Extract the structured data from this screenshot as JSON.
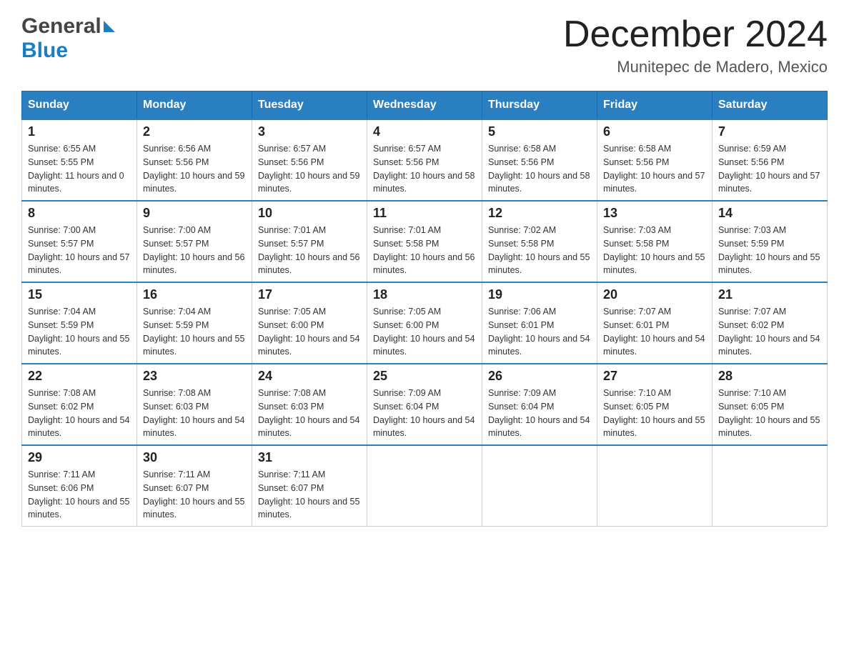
{
  "header": {
    "title": "December 2024",
    "subtitle": "Munitepec de Madero, Mexico",
    "logo_general": "General",
    "logo_blue": "Blue"
  },
  "days_of_week": [
    "Sunday",
    "Monday",
    "Tuesday",
    "Wednesday",
    "Thursday",
    "Friday",
    "Saturday"
  ],
  "weeks": [
    [
      {
        "day": "1",
        "sunrise": "6:55 AM",
        "sunset": "5:55 PM",
        "daylight": "11 hours and 0 minutes."
      },
      {
        "day": "2",
        "sunrise": "6:56 AM",
        "sunset": "5:56 PM",
        "daylight": "10 hours and 59 minutes."
      },
      {
        "day": "3",
        "sunrise": "6:57 AM",
        "sunset": "5:56 PM",
        "daylight": "10 hours and 59 minutes."
      },
      {
        "day": "4",
        "sunrise": "6:57 AM",
        "sunset": "5:56 PM",
        "daylight": "10 hours and 58 minutes."
      },
      {
        "day": "5",
        "sunrise": "6:58 AM",
        "sunset": "5:56 PM",
        "daylight": "10 hours and 58 minutes."
      },
      {
        "day": "6",
        "sunrise": "6:58 AM",
        "sunset": "5:56 PM",
        "daylight": "10 hours and 57 minutes."
      },
      {
        "day": "7",
        "sunrise": "6:59 AM",
        "sunset": "5:56 PM",
        "daylight": "10 hours and 57 minutes."
      }
    ],
    [
      {
        "day": "8",
        "sunrise": "7:00 AM",
        "sunset": "5:57 PM",
        "daylight": "10 hours and 57 minutes."
      },
      {
        "day": "9",
        "sunrise": "7:00 AM",
        "sunset": "5:57 PM",
        "daylight": "10 hours and 56 minutes."
      },
      {
        "day": "10",
        "sunrise": "7:01 AM",
        "sunset": "5:57 PM",
        "daylight": "10 hours and 56 minutes."
      },
      {
        "day": "11",
        "sunrise": "7:01 AM",
        "sunset": "5:58 PM",
        "daylight": "10 hours and 56 minutes."
      },
      {
        "day": "12",
        "sunrise": "7:02 AM",
        "sunset": "5:58 PM",
        "daylight": "10 hours and 55 minutes."
      },
      {
        "day": "13",
        "sunrise": "7:03 AM",
        "sunset": "5:58 PM",
        "daylight": "10 hours and 55 minutes."
      },
      {
        "day": "14",
        "sunrise": "7:03 AM",
        "sunset": "5:59 PM",
        "daylight": "10 hours and 55 minutes."
      }
    ],
    [
      {
        "day": "15",
        "sunrise": "7:04 AM",
        "sunset": "5:59 PM",
        "daylight": "10 hours and 55 minutes."
      },
      {
        "day": "16",
        "sunrise": "7:04 AM",
        "sunset": "5:59 PM",
        "daylight": "10 hours and 55 minutes."
      },
      {
        "day": "17",
        "sunrise": "7:05 AM",
        "sunset": "6:00 PM",
        "daylight": "10 hours and 54 minutes."
      },
      {
        "day": "18",
        "sunrise": "7:05 AM",
        "sunset": "6:00 PM",
        "daylight": "10 hours and 54 minutes."
      },
      {
        "day": "19",
        "sunrise": "7:06 AM",
        "sunset": "6:01 PM",
        "daylight": "10 hours and 54 minutes."
      },
      {
        "day": "20",
        "sunrise": "7:07 AM",
        "sunset": "6:01 PM",
        "daylight": "10 hours and 54 minutes."
      },
      {
        "day": "21",
        "sunrise": "7:07 AM",
        "sunset": "6:02 PM",
        "daylight": "10 hours and 54 minutes."
      }
    ],
    [
      {
        "day": "22",
        "sunrise": "7:08 AM",
        "sunset": "6:02 PM",
        "daylight": "10 hours and 54 minutes."
      },
      {
        "day": "23",
        "sunrise": "7:08 AM",
        "sunset": "6:03 PM",
        "daylight": "10 hours and 54 minutes."
      },
      {
        "day": "24",
        "sunrise": "7:08 AM",
        "sunset": "6:03 PM",
        "daylight": "10 hours and 54 minutes."
      },
      {
        "day": "25",
        "sunrise": "7:09 AM",
        "sunset": "6:04 PM",
        "daylight": "10 hours and 54 minutes."
      },
      {
        "day": "26",
        "sunrise": "7:09 AM",
        "sunset": "6:04 PM",
        "daylight": "10 hours and 54 minutes."
      },
      {
        "day": "27",
        "sunrise": "7:10 AM",
        "sunset": "6:05 PM",
        "daylight": "10 hours and 55 minutes."
      },
      {
        "day": "28",
        "sunrise": "7:10 AM",
        "sunset": "6:05 PM",
        "daylight": "10 hours and 55 minutes."
      }
    ],
    [
      {
        "day": "29",
        "sunrise": "7:11 AM",
        "sunset": "6:06 PM",
        "daylight": "10 hours and 55 minutes."
      },
      {
        "day": "30",
        "sunrise": "7:11 AM",
        "sunset": "6:07 PM",
        "daylight": "10 hours and 55 minutes."
      },
      {
        "day": "31",
        "sunrise": "7:11 AM",
        "sunset": "6:07 PM",
        "daylight": "10 hours and 55 minutes."
      },
      null,
      null,
      null,
      null
    ]
  ]
}
